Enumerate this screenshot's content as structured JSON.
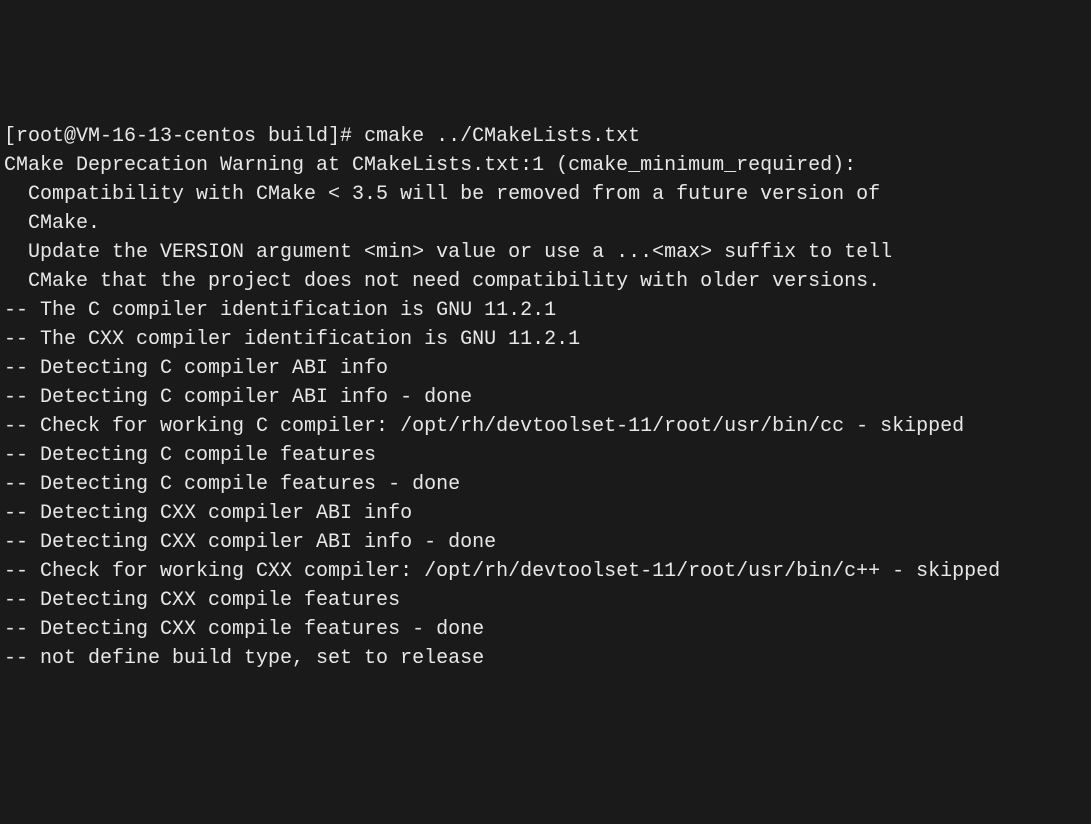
{
  "terminal": {
    "prompt": "[root@VM-16-13-centos build]# ",
    "command": "cmake ../CMakeLists.txt",
    "lines": [
      "CMake Deprecation Warning at CMakeLists.txt:1 (cmake_minimum_required):",
      "  Compatibility with CMake < 3.5 will be removed from a future version of",
      "  CMake.",
      "",
      "  Update the VERSION argument <min> value or use a ...<max> suffix to tell",
      "  CMake that the project does not need compatibility with older versions.",
      "",
      "",
      "-- The C compiler identification is GNU 11.2.1",
      "-- The CXX compiler identification is GNU 11.2.1",
      "-- Detecting C compiler ABI info",
      "-- Detecting C compiler ABI info - done",
      "-- Check for working C compiler: /opt/rh/devtoolset-11/root/usr/bin/cc - skipped",
      "-- Detecting C compile features",
      "-- Detecting C compile features - done",
      "-- Detecting CXX compiler ABI info",
      "-- Detecting CXX compiler ABI info - done",
      "-- Check for working CXX compiler: /opt/rh/devtoolset-11/root/usr/bin/c++ - skipped",
      "-- Detecting CXX compile features",
      "-- Detecting CXX compile features - done",
      "-- not define build type, set to release"
    ]
  }
}
